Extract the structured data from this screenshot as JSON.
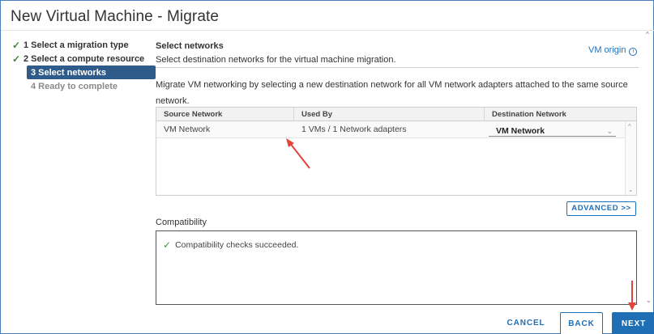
{
  "window": {
    "title": "New Virtual Machine - Migrate"
  },
  "steps": [
    {
      "label": "1 Select a migration type",
      "state": "done"
    },
    {
      "label": "2 Select a compute resource",
      "state": "done"
    },
    {
      "label": "3 Select networks",
      "state": "active"
    },
    {
      "label": "4 Ready to complete",
      "state": "future"
    }
  ],
  "page": {
    "heading": "Select networks",
    "subtitle": "Select destination networks for the virtual machine migration.",
    "vm_origin_link": "VM origin",
    "description": "Migrate VM networking by selecting a new destination network for all VM network adapters attached to the same source network."
  },
  "network_table": {
    "columns": [
      "Source Network",
      "Used By",
      "Destination Network"
    ],
    "rows": [
      {
        "source": "VM Network",
        "used_by": "1 VMs / 1 Network adapters",
        "destination": "VM Network"
      }
    ]
  },
  "advanced_button": "ADVANCED >>",
  "compatibility": {
    "label": "Compatibility",
    "message": "Compatibility checks succeeded."
  },
  "footer": {
    "cancel": "CANCEL",
    "back": "BACK",
    "next": "NEXT"
  },
  "colors": {
    "accent": "#1f6fb5",
    "active_step": "#2f5b8a",
    "success": "#3c8a2e",
    "annotation_arrow": "#e0443a"
  },
  "icons": {
    "step_done": "check-icon",
    "vm_origin": "info-icon",
    "dropdown": "chevron-down-icon",
    "compat_ok": "check-icon"
  }
}
